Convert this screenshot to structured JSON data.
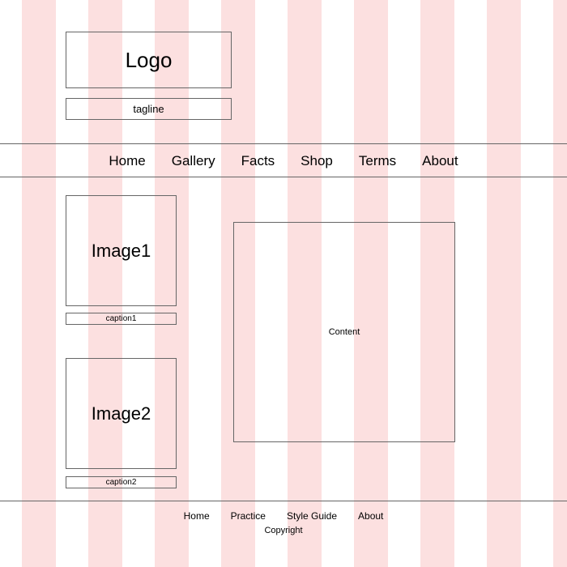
{
  "theme": {
    "stripe_color": "#fce0e0",
    "background_color": "#ffffff",
    "border_color": "#666666",
    "text_color": "#000000"
  },
  "header": {
    "logo": "Logo",
    "tagline": "tagline"
  },
  "nav": {
    "items": [
      {
        "label": "Home"
      },
      {
        "label": "Gallery"
      },
      {
        "label": "Facts"
      },
      {
        "label": "Shop"
      },
      {
        "label": "Terms"
      },
      {
        "label": "About"
      }
    ]
  },
  "main": {
    "images": [
      {
        "label": "Image1",
        "caption": "caption1"
      },
      {
        "label": "Image2",
        "caption": "caption2"
      }
    ],
    "content": {
      "label": "Content"
    }
  },
  "footer": {
    "links": [
      {
        "label": "Home"
      },
      {
        "label": "Practice"
      },
      {
        "label": "Style Guide"
      },
      {
        "label": "About"
      }
    ],
    "copyright": "Copyright"
  }
}
